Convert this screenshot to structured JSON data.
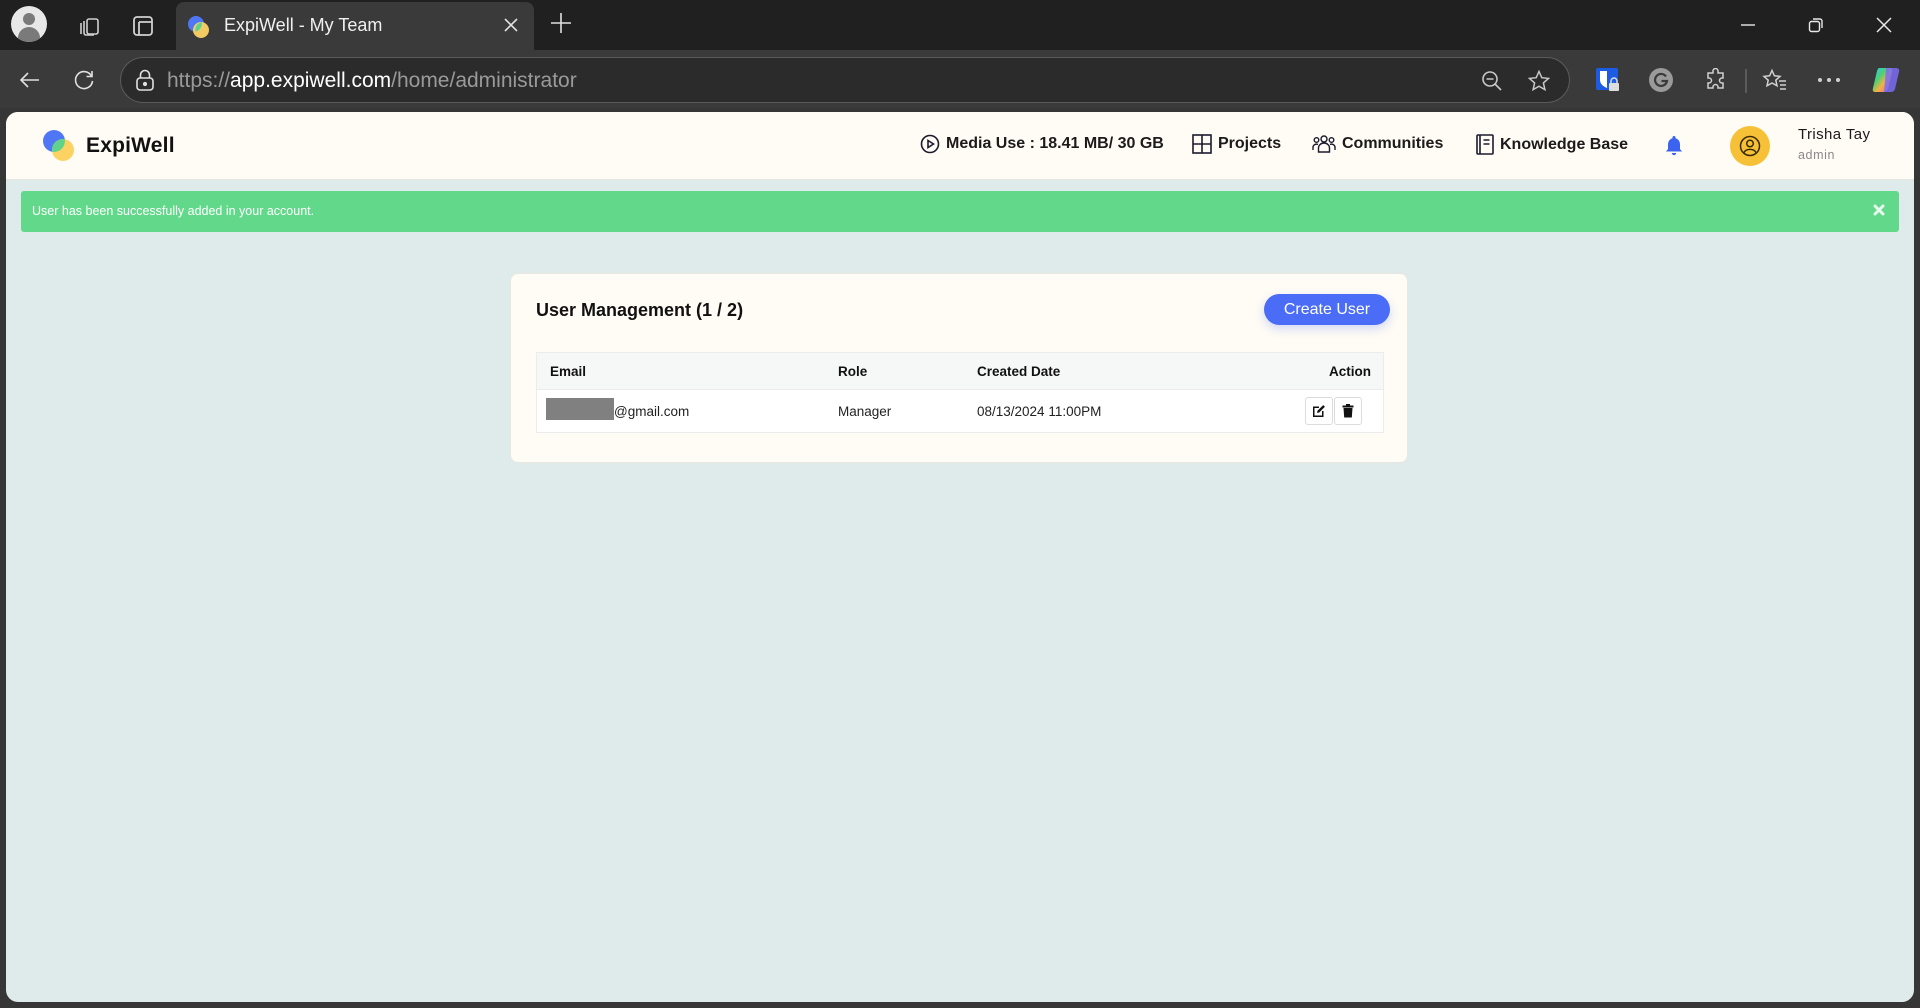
{
  "browser": {
    "tab_title": "ExpiWell - My Team",
    "url_scheme": "https://",
    "url_host": "app.expiwell.com",
    "url_path": "/home/administrator"
  },
  "header": {
    "brand": "ExpiWell",
    "media_use": "Media Use : 18.41 MB/ 30 GB",
    "nav": {
      "projects": "Projects",
      "communities": "Communities",
      "knowledge_base": "Knowledge Base"
    },
    "user": {
      "name": "Trisha Tay",
      "role": "admin"
    }
  },
  "alert": {
    "message": "User has been successfully added in your account."
  },
  "user_management": {
    "title": "User Management (1 / 2)",
    "create_button": "Create User",
    "columns": {
      "email": "Email",
      "role": "Role",
      "created_date": "Created Date",
      "action": "Action"
    },
    "rows": [
      {
        "email_suffix": "@gmail.com",
        "role": "Manager",
        "created_date": "08/13/2024 11:00PM"
      }
    ]
  },
  "colors": {
    "accent": "#4a6cf7",
    "success": "#62d98a",
    "avatar": "#f6c136",
    "page_bg": "#dfebeb",
    "header_bg": "#fffcf5"
  }
}
